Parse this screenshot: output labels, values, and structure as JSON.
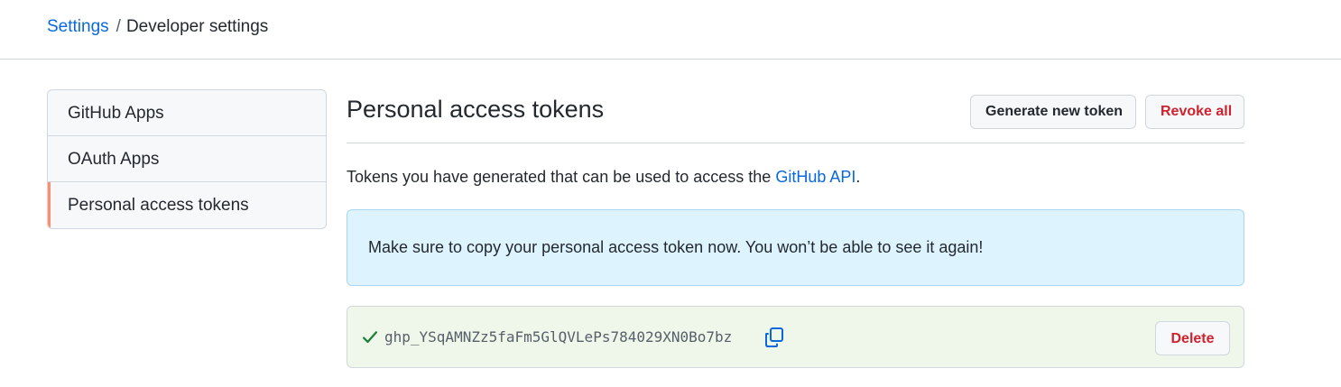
{
  "breadcrumb": {
    "parent": "Settings",
    "separator": "/",
    "current": "Developer settings"
  },
  "sidebar": {
    "items": [
      {
        "label": "GitHub Apps",
        "selected": false
      },
      {
        "label": "OAuth Apps",
        "selected": false
      },
      {
        "label": "Personal access tokens",
        "selected": true
      }
    ]
  },
  "main": {
    "title": "Personal access tokens",
    "generate_button": "Generate new token",
    "revoke_button": "Revoke all",
    "description_prefix": "Tokens you have generated that can be used to access the ",
    "description_link": "GitHub API",
    "description_suffix": ".",
    "flash_message": "Make sure to copy your personal access token now. You won’t be able to see it again!",
    "token": {
      "value": "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",
      "check_icon": "check-icon",
      "copy_icon": "copy-icon",
      "delete_button": "Delete"
    }
  },
  "colors": {
    "link": "#0969da",
    "danger": "#cf222e",
    "selected_accent": "#fd8c73",
    "info_bg": "#ddf4ff",
    "success_bg": "#eff7ea",
    "check": "#1a7f37"
  }
}
